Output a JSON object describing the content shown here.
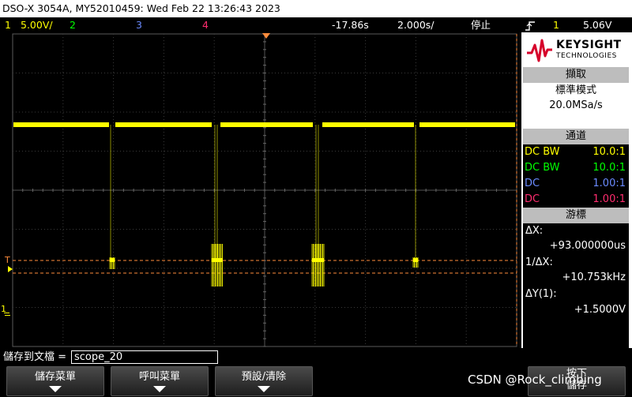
{
  "title": "DSO-X 3054A, MY52010459: Wed Feb 22 13:26:43 2023",
  "status": {
    "ch1_num": "1",
    "ch1_scale": "5.00V/",
    "ch2_num": "2",
    "ch3_num": "3",
    "ch4_num": "4",
    "time_offset": "-17.86s",
    "time_scale": "2.000s/",
    "run_state": "停止",
    "trig_icon": "trigger-edge-icon",
    "trig_ch": "1",
    "trig_level": "5.06V"
  },
  "screen_markers": {
    "ch1_ground": "1",
    "trig_marker": "T"
  },
  "panel": {
    "logo_line1": "KEYSIGHT",
    "logo_line2": "TECHNOLOGIES",
    "acq_header": "擷取",
    "acq_mode": "標準模式",
    "acq_rate": "20.0MSa/s",
    "chan_header": "通道",
    "channels": [
      {
        "coupling": "DC BW",
        "probe": "10.0:1",
        "color": "#ffff00"
      },
      {
        "coupling": "DC BW",
        "probe": "10.0:1",
        "color": "#00ff00"
      },
      {
        "coupling": "DC",
        "probe": "1.00:1",
        "color": "#6b8bff"
      },
      {
        "coupling": "DC",
        "probe": "1.00:1",
        "color": "#ff2d6f"
      }
    ],
    "cursor_header": "游標",
    "dx_label": "ΔX:",
    "dx_value": "+93.000000us",
    "inv_dx_label": "1/ΔX:",
    "inv_dx_value": "+10.753kHz",
    "dy_label": "ΔY(1):",
    "dy_value": "+1.5000V"
  },
  "bottom": {
    "file_label": "儲存到文檔 =",
    "file_name": "scope_20",
    "softkeys": [
      "儲存菜單",
      "呼叫菜單",
      "預設/清除",
      "按下\n儲存"
    ]
  },
  "watermark": "CSDN @Rock_climbing",
  "colors": {
    "ch1": "#ffff00",
    "ch2": "#00ff00",
    "ch3": "#6b8bff",
    "ch4": "#ff2d6f",
    "trigger_line": "#ff8c3c",
    "grid": "#3a3a3a"
  }
}
